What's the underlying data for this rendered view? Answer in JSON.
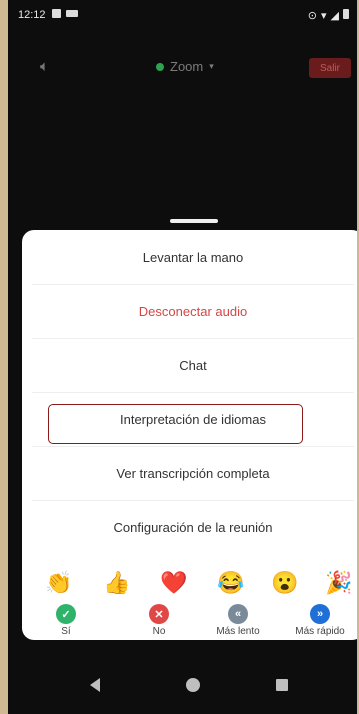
{
  "status_bar": {
    "time": "12:12"
  },
  "top_bar": {
    "title": "Zoom",
    "leave_label": "Salir"
  },
  "menu": {
    "items": [
      {
        "label": "Levantar la mano"
      },
      {
        "label": "Desconectar audio"
      },
      {
        "label": "Chat"
      },
      {
        "label": "Interpretación de idiomas"
      },
      {
        "label": "Ver transcripción completa"
      },
      {
        "label": "Configuración de la reunión"
      }
    ]
  },
  "reactions": {
    "emojis": [
      "clapping-hands",
      "thumbs-up",
      "red-heart",
      "tears-of-joy",
      "surprised-face",
      "party-popper"
    ]
  },
  "actions": [
    {
      "label": "Sí",
      "color": "#2fb36b"
    },
    {
      "label": "No",
      "color": "#e04848"
    },
    {
      "label": "Más lento",
      "color": "#7b8a99"
    },
    {
      "label": "Más rápido",
      "color": "#1f6fd6"
    }
  ]
}
